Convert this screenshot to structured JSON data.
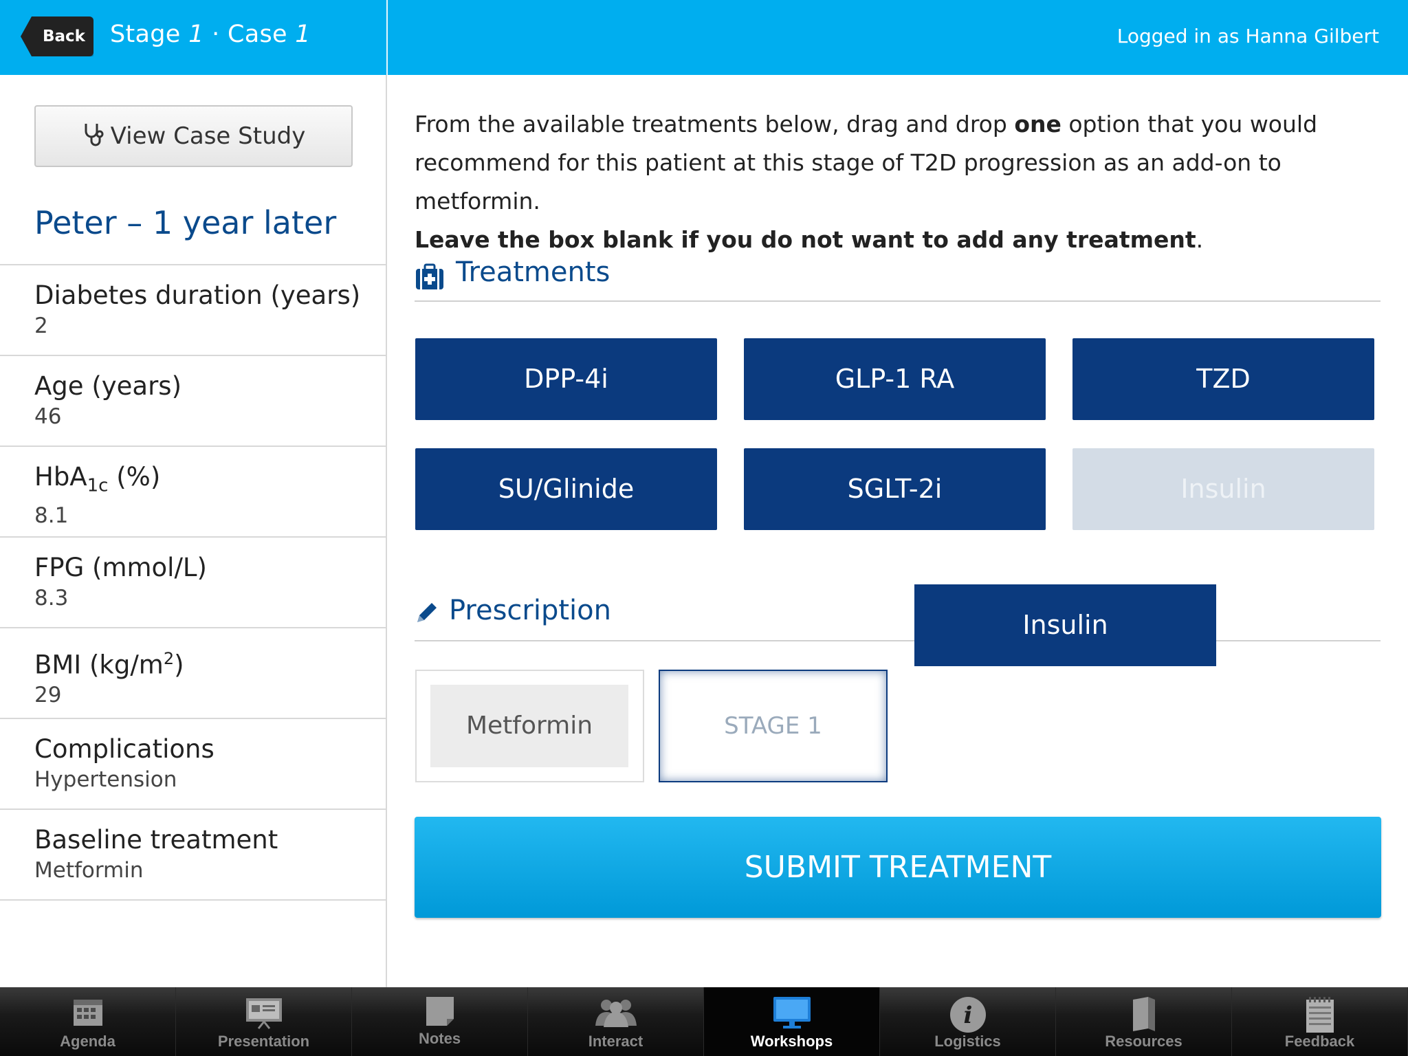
{
  "header": {
    "back_label": "Back",
    "stage_word": "Stage",
    "stage_num": "1",
    "separator": "·",
    "case_word": "Case",
    "case_num": "1",
    "login_text": "Logged in as Hanna Gilbert"
  },
  "sidebar": {
    "view_case_label": "View Case Study",
    "patient_title": "Peter – 1 year later",
    "items": [
      {
        "label": "Diabetes duration (years)",
        "value": "2"
      },
      {
        "label_pre": "Age (years)",
        "value": "46"
      },
      {
        "label_a": "HbA",
        "label_sub": "1c",
        "label_b": " (%)",
        "value": "8.1"
      },
      {
        "label": "FPG (mmol/L)",
        "value": "8.3"
      },
      {
        "label_a": "BMI (kg/m",
        "label_sup": "2",
        "label_b": ")",
        "value": "29"
      },
      {
        "label": "Complications",
        "value": "Hypertension"
      },
      {
        "label": "Baseline treatment",
        "value": "Metformin"
      }
    ]
  },
  "main": {
    "instr_1": "From the available treatments below, drag and drop ",
    "instr_bold": "one",
    "instr_2": " option that you would recommend for this patient at this stage of T2D progression as an add-on to metformin.",
    "instr_strong": "Leave the box blank if you do not want to add any treatment",
    "instr_end": ".",
    "treatments_title": "Treatments",
    "treatments": [
      "DPP-4i",
      "GLP-1 RA",
      "TZD",
      "SU/Glinide",
      "SGLT-2i",
      "Insulin"
    ],
    "dragging_label": "Insulin",
    "prescription_title": "Prescription",
    "baseline_box": "Metformin",
    "drop_placeholder": "STAGE 1",
    "submit_label": "SUBMIT TREATMENT"
  },
  "tabs": [
    "Agenda",
    "Presentation",
    "Notes",
    "Interact",
    "Workshops",
    "Logistics",
    "Resources",
    "Feedback"
  ],
  "active_tab": "Workshops",
  "colors": {
    "header": "#00aeef",
    "navy": "#0b3a7e",
    "title_blue": "#0a4a8c",
    "submit": "#0aa8e8"
  }
}
